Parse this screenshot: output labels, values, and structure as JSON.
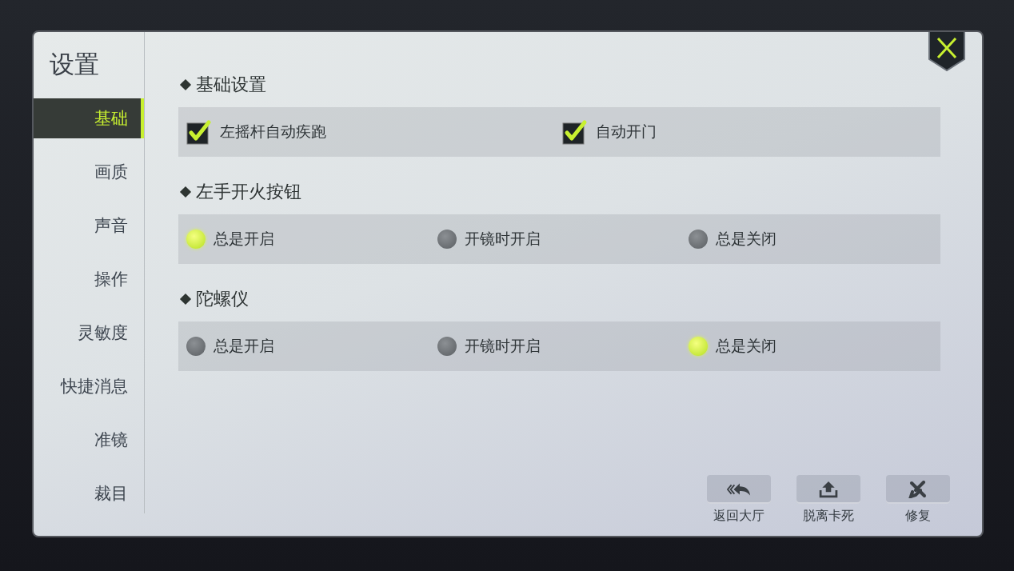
{
  "title": "设置",
  "sidebar": {
    "items": [
      {
        "label": "基础",
        "selected": true
      },
      {
        "label": "画质",
        "selected": false
      },
      {
        "label": "声音",
        "selected": false
      },
      {
        "label": "操作",
        "selected": false
      },
      {
        "label": "灵敏度",
        "selected": false
      },
      {
        "label": "快捷消息",
        "selected": false
      },
      {
        "label": "准镜",
        "selected": false
      },
      {
        "label": "裁目",
        "selected": false
      }
    ]
  },
  "sections": [
    {
      "title": "基础设置",
      "kind": "checkboxes",
      "options": [
        {
          "label": "左摇杆自动疾跑",
          "checked": true
        },
        {
          "label": "自动开门",
          "checked": true
        }
      ]
    },
    {
      "title": "左手开火按钮",
      "kind": "radios",
      "options": [
        {
          "label": "总是开启",
          "selected": true
        },
        {
          "label": "开镜时开启",
          "selected": false
        },
        {
          "label": "总是关闭",
          "selected": false
        }
      ]
    },
    {
      "title": "陀螺仪",
      "kind": "radios",
      "options": [
        {
          "label": "总是开启",
          "selected": false
        },
        {
          "label": "开镜时开启",
          "selected": false
        },
        {
          "label": "总是关闭",
          "selected": true
        }
      ]
    }
  ],
  "actions": [
    {
      "kind": "back",
      "label": "返回大厅"
    },
    {
      "kind": "unstuck",
      "label": "脱离卡死"
    },
    {
      "kind": "repair",
      "label": "修复"
    }
  ]
}
